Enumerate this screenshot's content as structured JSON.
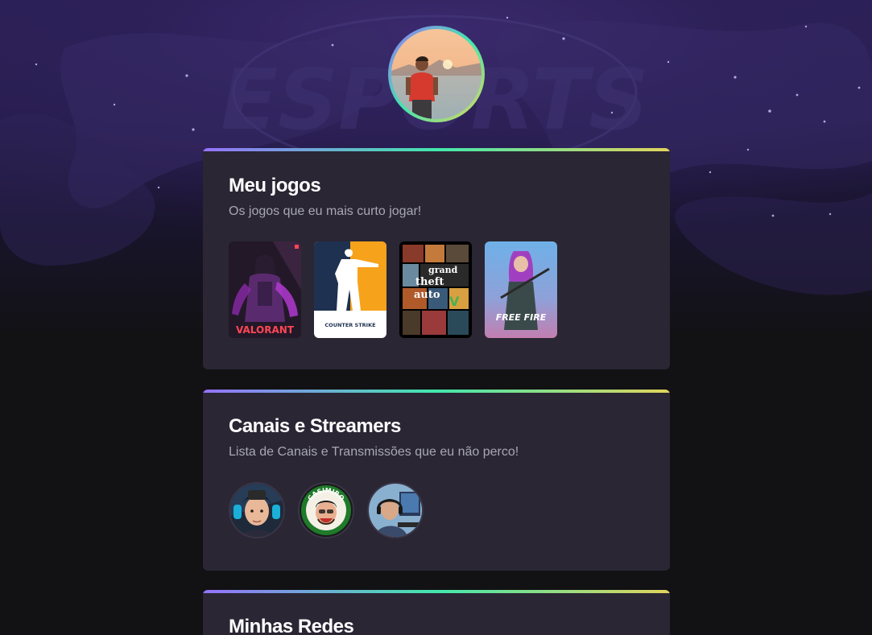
{
  "profile": {
    "avatar_alt": "Foto de perfil"
  },
  "sections": {
    "games": {
      "title": "Meu jogos",
      "subtitle": "Os jogos que eu mais curto jogar!",
      "items": [
        {
          "name": "Valorant",
          "logo_text": "VALORANT"
        },
        {
          "name": "Counter Strike",
          "logo_text": "COUNTER STRIKE"
        },
        {
          "name": "Grand Theft Auto V",
          "logo_text_1": "grand",
          "logo_text_2": "theft",
          "logo_text_3": "auto"
        },
        {
          "name": "Free Fire",
          "logo_text": "FREE FIRE"
        }
      ]
    },
    "streamers": {
      "title": "Canais e Streamers",
      "subtitle": "Lista de Canais e Transmissões que eu não perco!",
      "items": [
        {
          "name": "Streamer 1"
        },
        {
          "name": "Casimiro",
          "badge_text": "CASIMIRO"
        },
        {
          "name": "Streamer 3"
        }
      ]
    },
    "socials": {
      "title": "Minhas Redes"
    }
  },
  "hero": {
    "watermark_text": "ESPORTS"
  },
  "colors": {
    "page_bg": "#121214",
    "card_bg": "#2a2634",
    "gradient_start": "#9572FC",
    "gradient_mid": "#43E7AD",
    "gradient_end": "#E2D45C",
    "title": "#ffffff",
    "subtitle": "#a8a8b3"
  }
}
